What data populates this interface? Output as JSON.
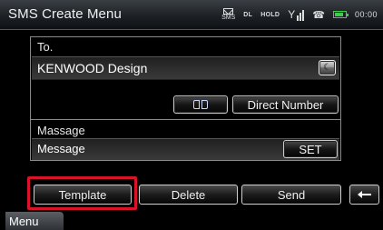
{
  "header": {
    "title": "SMS Create Menu",
    "status": {
      "sms_label": "SMS",
      "dl_label": "DL",
      "hold_label": "HOLD",
      "clock": "00:00",
      "icons": [
        "sms-icon",
        "antenna-icon",
        "phone-icon",
        "battery-icon"
      ]
    }
  },
  "to_section": {
    "label": "To.",
    "value": "KENWOOD Design",
    "clear_button_icon": "moon-icon",
    "phonebook_button_icon": "book-icon",
    "direct_number_label": "Direct Number"
  },
  "message_section": {
    "label": "Massage",
    "value": "Message",
    "set_label": "SET"
  },
  "bottom_bar": {
    "template_label": "Template",
    "delete_label": "Delete",
    "send_label": "Send",
    "back_icon": "return-icon"
  },
  "menu_tab_label": "Menu",
  "colors": {
    "highlight": "#d9142a",
    "battery": "#3ad14a"
  }
}
